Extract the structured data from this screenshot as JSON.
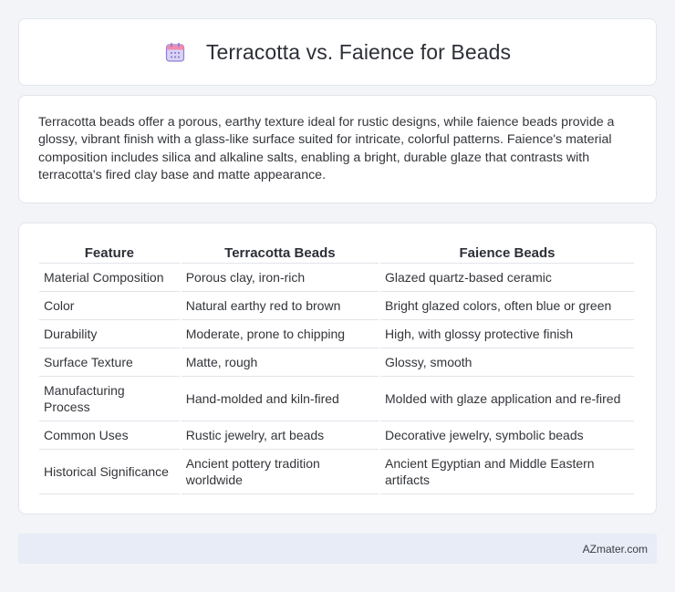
{
  "header": {
    "title": "Terracotta vs. Faience for Beads",
    "icon": "calendar-icon"
  },
  "intro": {
    "text": "Terracotta beads offer a porous, earthy texture ideal for rustic designs, while faience beads provide a glossy, vibrant finish with a glass-like surface suited for intricate, colorful patterns. Faience's material composition includes silica and alkaline salts, enabling a bright, durable glaze that contrasts with terracotta's fired clay base and matte appearance."
  },
  "table": {
    "headers": [
      "Feature",
      "Terracotta Beads",
      "Faience Beads"
    ],
    "rows": [
      [
        "Material Composition",
        "Porous clay, iron-rich",
        "Glazed quartz-based ceramic"
      ],
      [
        "Color",
        "Natural earthy red to brown",
        "Bright glazed colors, often blue or green"
      ],
      [
        "Durability",
        "Moderate, prone to chipping",
        "High, with glossy protective finish"
      ],
      [
        "Surface Texture",
        "Matte, rough",
        "Glossy, smooth"
      ],
      [
        "Manufacturing Process",
        "Hand-molded and kiln-fired",
        "Molded with glaze application and re-fired"
      ],
      [
        "Common Uses",
        "Rustic jewelry, art beads",
        "Decorative jewelry, symbolic beads"
      ],
      [
        "Historical Significance",
        "Ancient pottery tradition worldwide",
        "Ancient Egyptian and Middle Eastern artifacts"
      ]
    ]
  },
  "footer": {
    "text": "AZmater.com"
  },
  "colors": {
    "background": "#f3f4f8",
    "card": "#ffffff",
    "footer_bg": "#e8ecf6",
    "icon_purple": "#8e7fd6",
    "icon_pink": "#f08cb0"
  }
}
